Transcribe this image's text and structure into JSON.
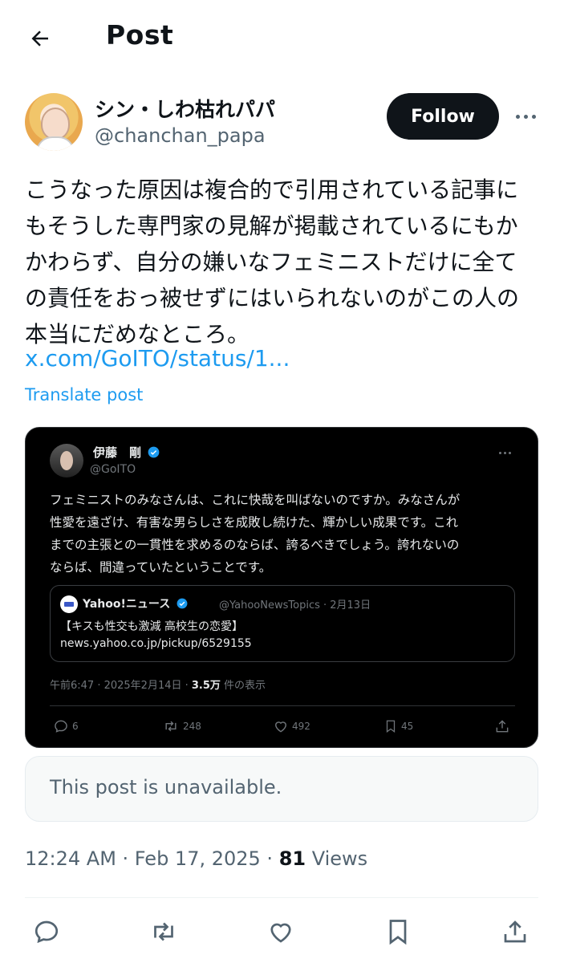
{
  "header": {
    "title": "Post"
  },
  "post": {
    "display_name": "シン・しわ枯れパパ",
    "handle": "@chanchan_papa",
    "follow_label": "Follow",
    "lines": [
      "こうなった原因は複合的で引用されている記事に",
      "もそうした専門家の見解が掲載されているにもか",
      "かわらず、自分の嫌いなフェミニストだけに全て",
      "の責任をおっ被せずにはいられないのがこの人の",
      "本当にだめなところ。"
    ],
    "link": "x.com/GoITO/status/1...",
    "translate": "Translate post"
  },
  "embed": {
    "name": "伊藤　剛",
    "handle": "@GoITO",
    "lines": [
      "フェミニストのみなさんは、これに快哉を叫ばないのですか。みなさんが",
      "性愛を遠ざけ、有害な男らしさを成敗し続けた、輝かしい成果です。これ",
      "までの主張との一貫性を求めるのならば、誇るべきでしょう。誇れないの",
      "ならば、間違っていたということです。"
    ],
    "quote": {
      "name": "Yahoo!ニュース",
      "meta": "@YahooNewsTopics · 2月13日",
      "title": "【キスも性交も激減 高校生の恋愛】",
      "url": "news.yahoo.co.jp/pickup/6529155"
    },
    "time": "午前6:47 · 2025年2月14日 · ",
    "views_count": "3.5万",
    "views_label": " 件の表示",
    "replies": "6",
    "reposts": "248",
    "likes": "492",
    "bookmarks": "45"
  },
  "unavailable": "This post is unavailable.",
  "meta": {
    "time": "12:24 AM · Feb 17, 2025 · ",
    "views_count": "81",
    "views_label": " Views"
  }
}
